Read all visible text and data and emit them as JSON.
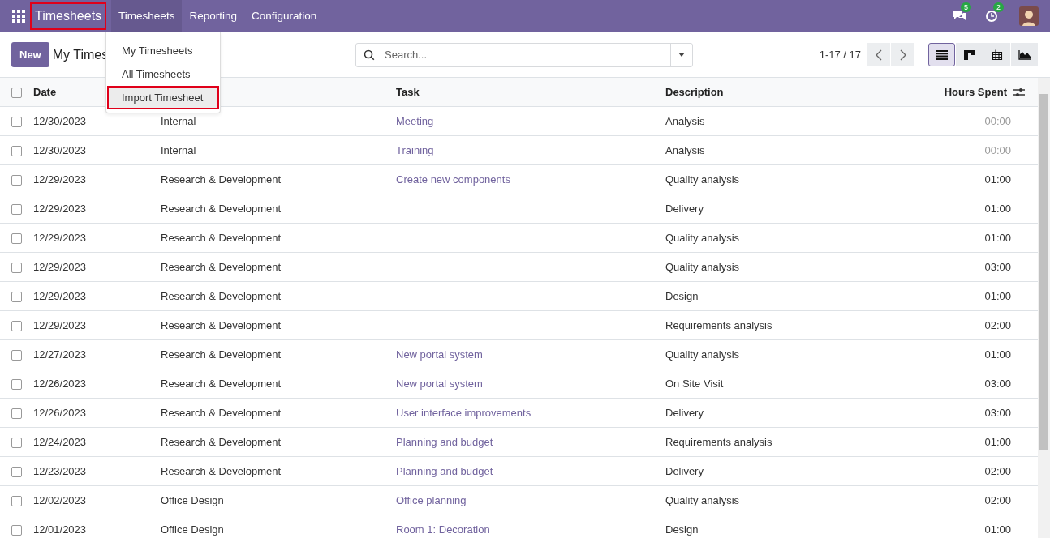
{
  "navbar": {
    "app_name": "Timesheets",
    "app_name_highlighted": true,
    "menus": [
      {
        "label": "Timesheets",
        "selected": true
      },
      {
        "label": "Reporting",
        "selected": false
      },
      {
        "label": "Configuration",
        "selected": false
      }
    ],
    "messages_badge": "5",
    "activities_badge": "2"
  },
  "dropdown": {
    "items": [
      {
        "label": "My Timesheets",
        "highlighted": false
      },
      {
        "label": "All Timesheets",
        "highlighted": false
      },
      {
        "label": "Import Timesheet",
        "highlighted": true
      }
    ]
  },
  "control_panel": {
    "new_button": "New",
    "breadcrumb": "My Times",
    "search": {
      "placeholder": "Search..."
    },
    "pager": "1-17 / 17",
    "views": [
      {
        "kind": "list",
        "selected": true
      },
      {
        "kind": "kanban",
        "selected": false
      },
      {
        "kind": "grid",
        "selected": false
      },
      {
        "kind": "graph",
        "selected": false
      }
    ]
  },
  "table": {
    "select_all_checked": false,
    "columns": [
      "Date",
      "",
      "Task",
      "Description",
      "Hours Spent"
    ],
    "rows": [
      {
        "date": "12/30/2023",
        "project": "Internal",
        "task": "Meeting",
        "description": "Analysis",
        "hours": "00:00",
        "zero": true,
        "checked": false
      },
      {
        "date": "12/30/2023",
        "project": "Internal",
        "task": "Training",
        "description": "Analysis",
        "hours": "00:00",
        "zero": true,
        "checked": false
      },
      {
        "date": "12/29/2023",
        "project": "Research & Development",
        "task": "Create new components",
        "description": "Quality analysis",
        "hours": "01:00",
        "zero": false,
        "checked": false
      },
      {
        "date": "12/29/2023",
        "project": "Research & Development",
        "task": "",
        "description": "Delivery",
        "hours": "01:00",
        "zero": false,
        "checked": false
      },
      {
        "date": "12/29/2023",
        "project": "Research & Development",
        "task": "",
        "description": "Quality analysis",
        "hours": "01:00",
        "zero": false,
        "checked": false
      },
      {
        "date": "12/29/2023",
        "project": "Research & Development",
        "task": "",
        "description": "Quality analysis",
        "hours": "03:00",
        "zero": false,
        "checked": false
      },
      {
        "date": "12/29/2023",
        "project": "Research & Development",
        "task": "",
        "description": "Design",
        "hours": "01:00",
        "zero": false,
        "checked": false
      },
      {
        "date": "12/29/2023",
        "project": "Research & Development",
        "task": "",
        "description": "Requirements analysis",
        "hours": "02:00",
        "zero": false,
        "checked": false
      },
      {
        "date": "12/27/2023",
        "project": "Research & Development",
        "task": "New portal system",
        "description": "Quality analysis",
        "hours": "01:00",
        "zero": false,
        "checked": false
      },
      {
        "date": "12/26/2023",
        "project": "Research & Development",
        "task": "New portal system",
        "description": "On Site Visit",
        "hours": "03:00",
        "zero": false,
        "checked": false
      },
      {
        "date": "12/26/2023",
        "project": "Research & Development",
        "task": "User interface improvements",
        "description": "Delivery",
        "hours": "03:00",
        "zero": false,
        "checked": false
      },
      {
        "date": "12/24/2023",
        "project": "Research & Development",
        "task": "Planning and budget",
        "description": "Requirements analysis",
        "hours": "01:00",
        "zero": false,
        "checked": false
      },
      {
        "date": "12/23/2023",
        "project": "Research & Development",
        "task": "Planning and budget",
        "description": "Delivery",
        "hours": "02:00",
        "zero": false,
        "checked": false
      },
      {
        "date": "12/02/2023",
        "project": "Office Design",
        "task": "Office planning",
        "description": "Quality analysis",
        "hours": "02:00",
        "zero": false,
        "checked": false
      },
      {
        "date": "12/01/2023",
        "project": "Office Design",
        "task": "Room 1: Decoration",
        "description": "Design",
        "hours": "01:00",
        "zero": false,
        "checked": false
      }
    ]
  }
}
